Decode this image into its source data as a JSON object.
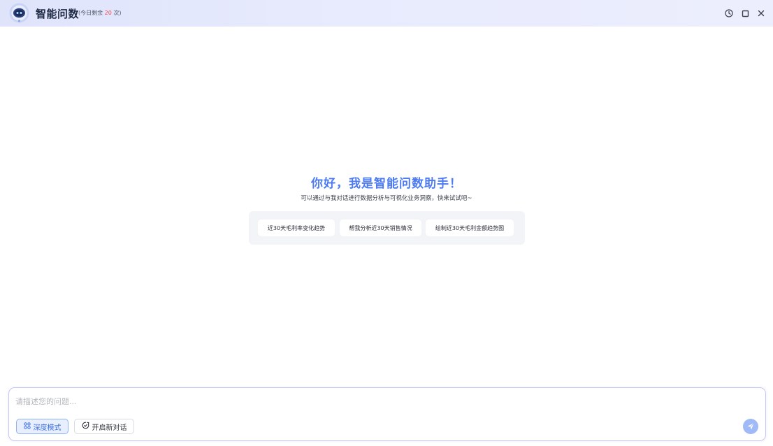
{
  "header": {
    "title": "智能问数",
    "quota_prefix": "(今日剩余",
    "quota_count": "20",
    "quota_suffix": "次)",
    "icons": [
      "logo-robot-icon",
      "history-clock-icon",
      "maximize-icon",
      "close-icon"
    ]
  },
  "welcome": {
    "title": "你好，我是智能问数助手！",
    "subtitle": "可以通过与我对话进行数据分析与可视化业务洞察，快来试试吧~"
  },
  "suggestions": [
    "近30天毛利率变化趋势",
    "帮我分析近30天销售情况",
    "绘制近30天毛利金额趋势图"
  ],
  "composer": {
    "placeholder": "请描述您的问题...",
    "deep_mode_label": "深度模式",
    "new_chat_label": "开启新对话",
    "icons": [
      "deep-mode-icon",
      "new-chat-icon",
      "send-icon"
    ]
  },
  "colors": {
    "accent": "#4d7bf3",
    "quota_highlight": "#f5484c",
    "header_bg": "#e4e8fc",
    "send_button": "#9fbaf7"
  }
}
